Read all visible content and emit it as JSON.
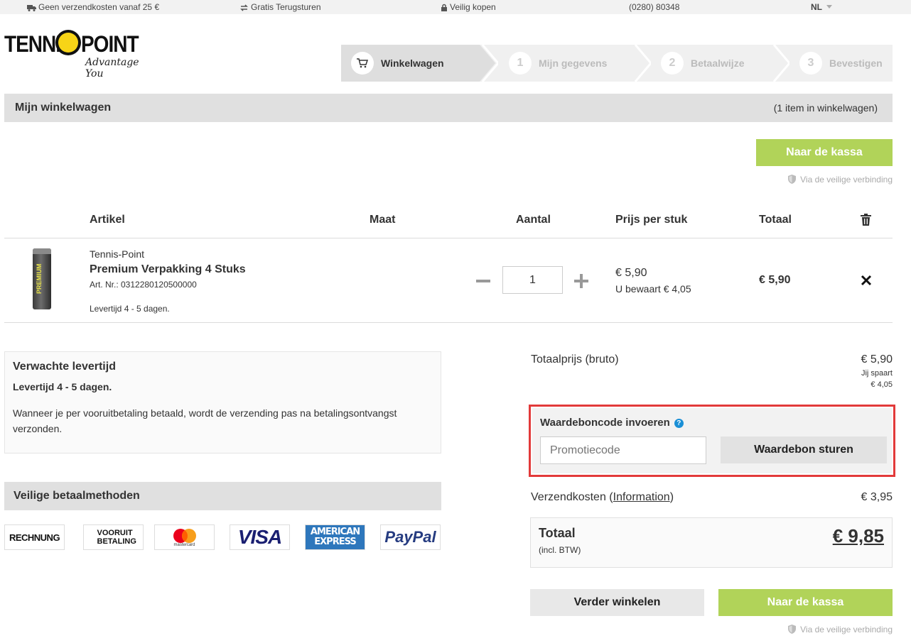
{
  "topbar": {
    "shipping": "Geen verzendkosten vanaf 25 €",
    "returns": "Gratis Terugsturen",
    "secure": "Veilig kopen",
    "phone": "(0280) 80348",
    "language": "NL"
  },
  "logo": {
    "left": "TENNIS",
    "right": "POINT",
    "tagline": "Advantage You"
  },
  "steps": [
    {
      "label": "Winkelwagen"
    },
    {
      "num": "1",
      "label": "Mijn gegevens"
    },
    {
      "num": "2",
      "label": "Betaalwijze"
    },
    {
      "num": "3",
      "label": "Bevestigen"
    }
  ],
  "cart": {
    "title": "Mijn winkelwagen",
    "count": "(1 item in winkelwagen)"
  },
  "checkout": {
    "top_label": "Naar de kassa",
    "secure_label": "Via de veilige verbinding"
  },
  "table": {
    "headers": {
      "article": "Artikel",
      "size": "Maat",
      "quantity": "Aantal",
      "unit_price": "Prijs per stuk",
      "total": "Totaal"
    }
  },
  "item": {
    "image_text": "PREMIUM",
    "brand": "Tennis-Point",
    "name": "Premium Verpakking 4 Stuks",
    "art_nr": "Art. Nr.: 0312280120500000",
    "delivery": "Levertijd 4 - 5 dagen.",
    "quantity": "1",
    "price": "€ 5,90",
    "savings": "U bewaart € 4,05",
    "total": "€ 5,90"
  },
  "delivery_box": {
    "title": "Verwachte levertijd",
    "subtitle": "Levertijd 4 - 5 dagen.",
    "text": "Wanneer je per vooruitbetaling betaald, wordt de verzending pas na betalingsontvangst verzonden."
  },
  "payment": {
    "title": "Veilige betaalmethoden",
    "methods": [
      {
        "name": "rechnung",
        "text": "RECHNUNG"
      },
      {
        "name": "vooruit-betaling",
        "text": "VOORUIT BETALING"
      },
      {
        "name": "mastercard",
        "text": "mastercard"
      },
      {
        "name": "visa",
        "text": "VISA"
      },
      {
        "name": "american-express",
        "text": "AMERICAN EXPRESS"
      },
      {
        "name": "paypal",
        "text": "PayPal"
      }
    ]
  },
  "summary": {
    "gross_label": "Totaalprijs (bruto)",
    "gross_value": "€ 5,90",
    "save_label": "Jij spaart",
    "save_value": "€ 4,05",
    "coupon_title": "Waardeboncode invoeren",
    "coupon_help": "?",
    "coupon_placeholder": "Promotiecode",
    "coupon_button": "Waardebon sturen",
    "shipping_label": "Verzendkosten",
    "shipping_info": "Information",
    "shipping_value": "€ 3,95",
    "total_label": "Totaal",
    "total_sub": "(incl. BTW)",
    "total_value": "€ 9,85",
    "continue_label": "Verder winkelen",
    "checkout_label": "Naar de kassa",
    "secure_label": "Via de veilige verbinding"
  },
  "colors": {
    "green": "#b1d359",
    "highlight": "#e23a3a",
    "help": "#1a8fd6"
  }
}
